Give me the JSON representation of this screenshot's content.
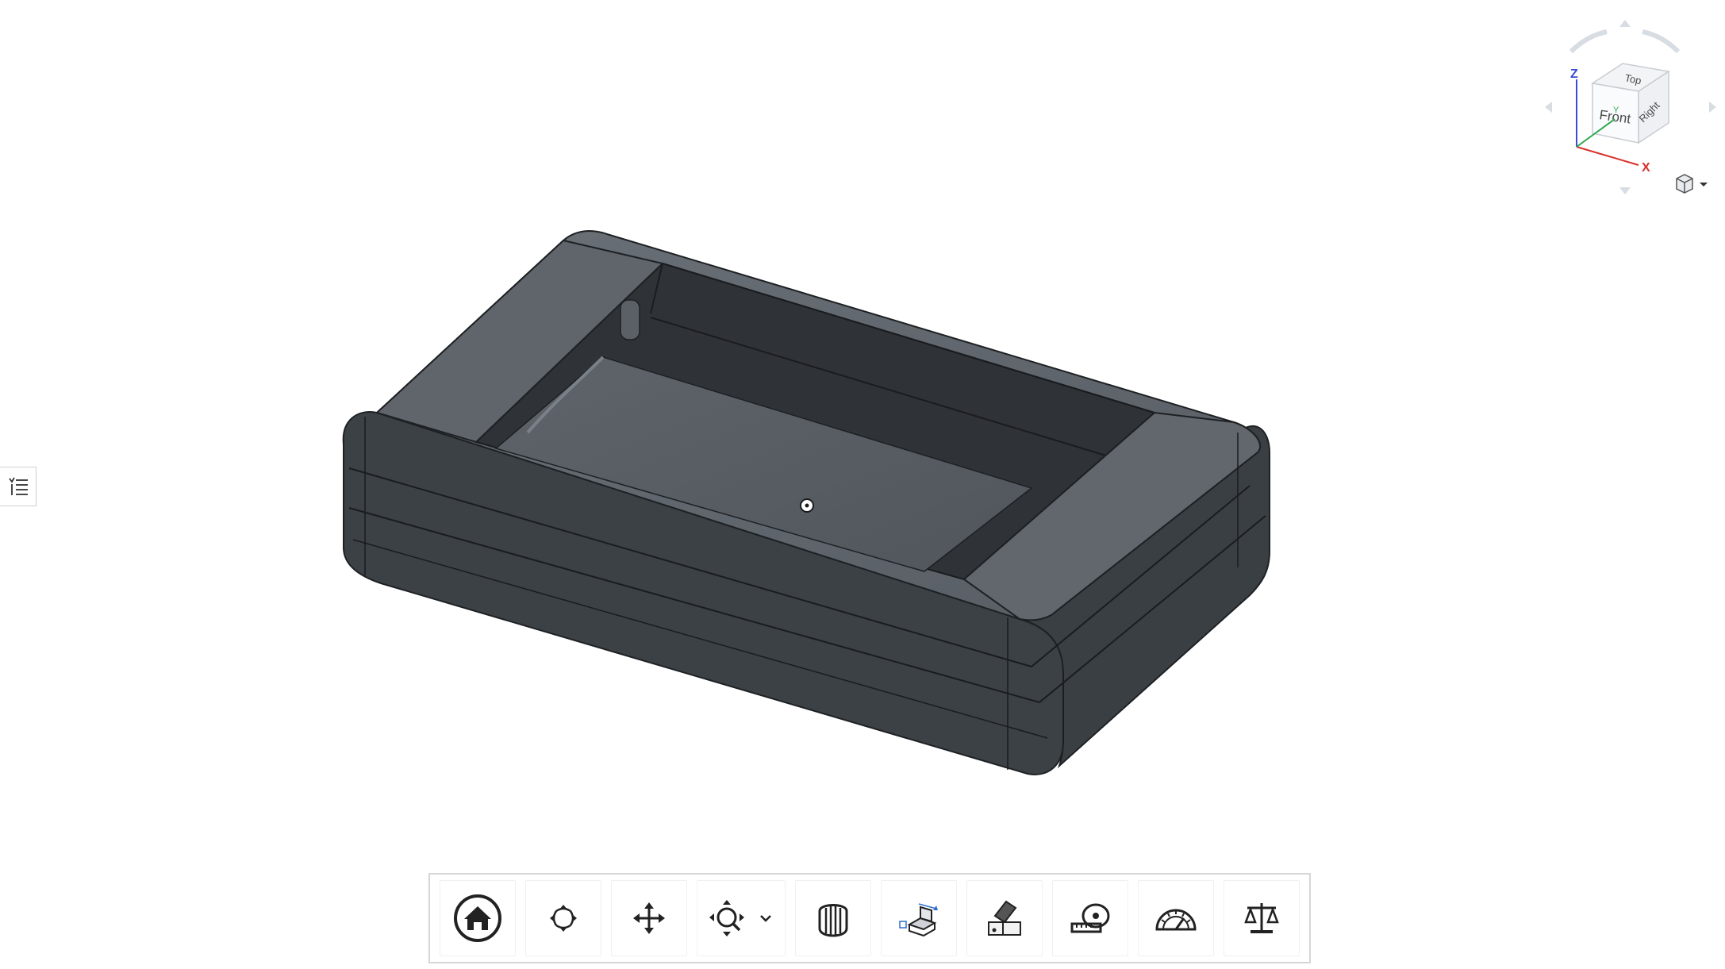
{
  "view_cube": {
    "faces": {
      "top": "Top",
      "front": "Front",
      "right": "Right"
    },
    "axes": {
      "x": "X",
      "y": "Y",
      "z": "Z"
    },
    "colors": {
      "x": "#d9302c",
      "y": "#2fa84f",
      "z": "#3a4bd6"
    }
  },
  "viewport": {
    "model_color": "#4a4f55",
    "background": "#ffffff"
  },
  "toolbar": {
    "tools": [
      {
        "icon": "home-icon",
        "tooltip": ""
      },
      {
        "icon": "orbit-icon",
        "tooltip": ""
      },
      {
        "icon": "pan-icon",
        "tooltip": ""
      },
      {
        "icon": "zoom-icon",
        "tooltip": ""
      },
      {
        "icon": "explode-icon",
        "tooltip": ""
      },
      {
        "icon": "section-icon",
        "tooltip": ""
      },
      {
        "icon": "appearance-icon",
        "tooltip": ""
      },
      {
        "icon": "measure-icon",
        "tooltip": ""
      },
      {
        "icon": "angle-icon",
        "tooltip": ""
      },
      {
        "icon": "mass-properties-icon",
        "tooltip": ""
      }
    ]
  }
}
